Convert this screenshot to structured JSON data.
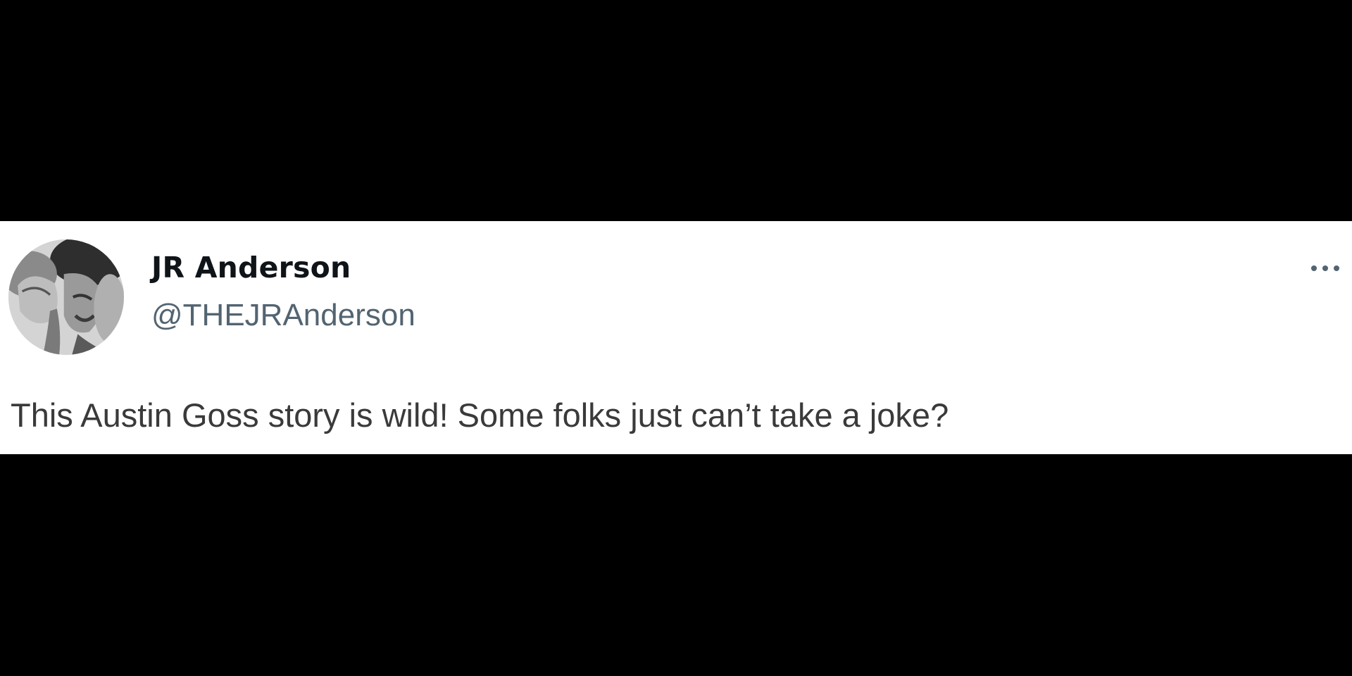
{
  "tweet": {
    "display_name": "JR Anderson",
    "handle": "@THEJRAnderson",
    "text": "This Austin Goss story is wild! Some folks just can’t take a joke?",
    "avatar_icon": "profile-photo",
    "more_icon": "more-horizontal-icon"
  },
  "colors": {
    "background": "#000000",
    "card": "#ffffff",
    "name": "#0f1419",
    "secondary": "#536471",
    "body_text": "#3a3a3a"
  }
}
